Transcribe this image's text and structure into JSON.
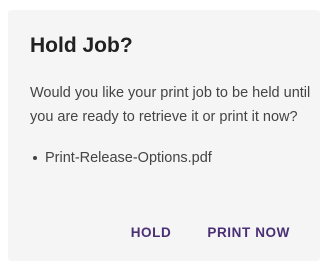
{
  "dialog": {
    "title": "Hold Job?",
    "message": "Would you like your print job to be held until you are ready to retrieve it or print it now?",
    "files": [
      "Print-Release-Options.pdf"
    ],
    "hold_label": "HOLD",
    "print_now_label": "PRINT NOW",
    "accent_color": "#4a2f75"
  }
}
